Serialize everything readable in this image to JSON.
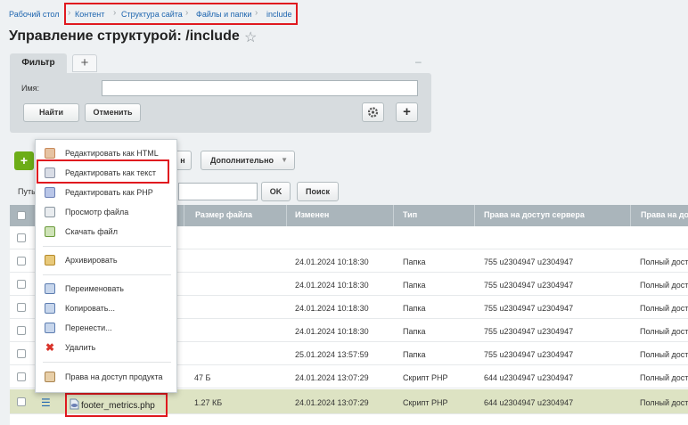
{
  "breadcrumb": {
    "first": "Рабочий стол",
    "items": [
      "Контент",
      "Структура сайта",
      "Файлы и папки",
      "include"
    ]
  },
  "page": {
    "title": "Управление структурой: /include"
  },
  "filter": {
    "tab_label": "Фильтр",
    "add_label": "+",
    "minimize_label": "–",
    "name_label": "Имя:",
    "name_value": "",
    "find_label": "Найти",
    "cancel_label": "Отменить",
    "plus_label": "+"
  },
  "toolbar": {
    "add_label": "+",
    "partial_label": "н",
    "more_label": "Дополнительно",
    "path_label": "Путь",
    "ok_label": "OK",
    "search_label": "Поиск"
  },
  "table": {
    "headers": [
      "Размер файла",
      "Изменен",
      "Тип",
      "Права на доступ сервера",
      "Права на до"
    ],
    "rows": [
      {
        "name": "",
        "size": "",
        "modified": "",
        "type": "",
        "server": "",
        "access": ""
      },
      {
        "name": "",
        "size": "",
        "modified": "24.01.2024 10:18:30",
        "type": "Папка",
        "server": "755 u2304947 u2304947",
        "access": "Полный дост"
      },
      {
        "name": "",
        "size": "",
        "modified": "24.01.2024 10:18:30",
        "type": "Папка",
        "server": "755 u2304947 u2304947",
        "access": "Полный дост"
      },
      {
        "name": "",
        "size": "",
        "modified": "24.01.2024 10:18:30",
        "type": "Папка",
        "server": "755 u2304947 u2304947",
        "access": "Полный дост"
      },
      {
        "name": "",
        "size": "",
        "modified": "24.01.2024 10:18:30",
        "type": "Папка",
        "server": "755 u2304947 u2304947",
        "access": "Полный дост"
      },
      {
        "name": "",
        "size": "",
        "modified": "25.01.2024 13:57:59",
        "type": "Папка",
        "server": "755 u2304947 u2304947",
        "access": "Полный дост"
      },
      {
        "name": "",
        "size": "47 Б",
        "modified": "24.01.2024 13:07:29",
        "type": "Скрипт PHP",
        "server": "644 u2304947 u2304947",
        "access": "Полный дост"
      },
      {
        "name": "footer_metrics.php",
        "size": "1.27 КБ",
        "modified": "24.01.2024 13:07:29",
        "type": "Скрипт PHP",
        "server": "644 u2304947 u2304947",
        "access": "Полный дост"
      }
    ]
  },
  "context_menu": {
    "items": [
      {
        "label": "Редактировать как HTML",
        "icon": "html-edit-icon"
      },
      {
        "label": "Редактировать как текст",
        "icon": "text-edit-icon"
      },
      {
        "label": "Редактировать как PHP",
        "icon": "php-edit-icon"
      },
      {
        "label": "Просмотр файла",
        "icon": "view-file-icon"
      },
      {
        "label": "Скачать файл",
        "icon": "download-icon"
      },
      {
        "label": "Архивировать",
        "icon": "archive-icon"
      },
      {
        "label": "Переименовать",
        "icon": "rename-icon"
      },
      {
        "label": "Копировать...",
        "icon": "copy-icon"
      },
      {
        "label": "Перенести...",
        "icon": "move-icon"
      },
      {
        "label": "Удалить",
        "icon": "delete-icon"
      },
      {
        "label": "Права на доступ продукта",
        "icon": "access-rights-icon"
      }
    ]
  },
  "colors": {
    "accent_link": "#2067b0",
    "highlight_box": "#e0191f",
    "header_bg": "#aab5bb",
    "selected_row": "#dde3c3",
    "add_button": "#6cad17"
  }
}
